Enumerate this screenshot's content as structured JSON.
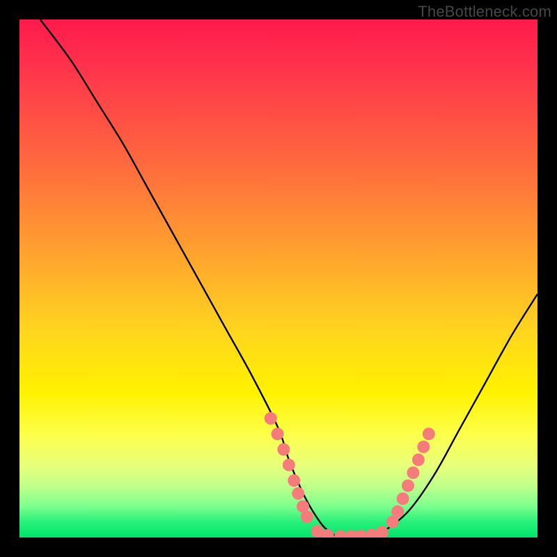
{
  "watermark": "TheBottleneck.com",
  "chart_data": {
    "type": "line",
    "title": "",
    "xlabel": "",
    "ylabel": "",
    "xlim": [
      0,
      100
    ],
    "ylim": [
      0,
      100
    ],
    "grid": false,
    "series": [
      {
        "name": "bottleneck-curve",
        "type": "line",
        "color": "#000000",
        "x": [
          4,
          10,
          15,
          20,
          25,
          30,
          35,
          40,
          45,
          50,
          52,
          55,
          58,
          60,
          62,
          65,
          68,
          70,
          75,
          80,
          85,
          90,
          95,
          100
        ],
        "y": [
          100,
          92,
          84,
          76,
          67,
          58,
          49,
          40,
          31,
          21,
          15,
          8,
          3,
          1,
          0,
          0,
          0,
          1,
          5,
          12,
          21,
          30,
          39,
          47
        ]
      },
      {
        "name": "highlight-dots",
        "type": "scatter",
        "color": "#f67b7b",
        "points": [
          [
            48.5,
            23
          ],
          [
            49.8,
            20
          ],
          [
            51.0,
            17
          ],
          [
            52.0,
            14
          ],
          [
            53.0,
            11
          ],
          [
            53.8,
            8.5
          ],
          [
            54.7,
            6
          ],
          [
            55.5,
            4
          ],
          [
            57.5,
            1.2
          ],
          [
            59.5,
            0.4
          ],
          [
            62.0,
            0.2
          ],
          [
            64.0,
            0.2
          ],
          [
            65.8,
            0.3
          ],
          [
            68.0,
            0.5
          ],
          [
            70.0,
            1.0
          ],
          [
            72.0,
            3.0
          ],
          [
            73.0,
            5.0
          ],
          [
            74.0,
            7.5
          ],
          [
            75.0,
            10.0
          ],
          [
            76.0,
            12.5
          ],
          [
            77.0,
            15.0
          ],
          [
            78.0,
            17.5
          ],
          [
            79.0,
            20.0
          ]
        ]
      }
    ],
    "background_gradient": {
      "stops": [
        {
          "pos": 0,
          "color": "#ff1a4d"
        },
        {
          "pos": 28,
          "color": "#ff6a3e"
        },
        {
          "pos": 60,
          "color": "#ffd51f"
        },
        {
          "pos": 80,
          "color": "#fdff4a"
        },
        {
          "pos": 94,
          "color": "#7dff8e"
        },
        {
          "pos": 100,
          "color": "#00e46a"
        }
      ]
    }
  }
}
